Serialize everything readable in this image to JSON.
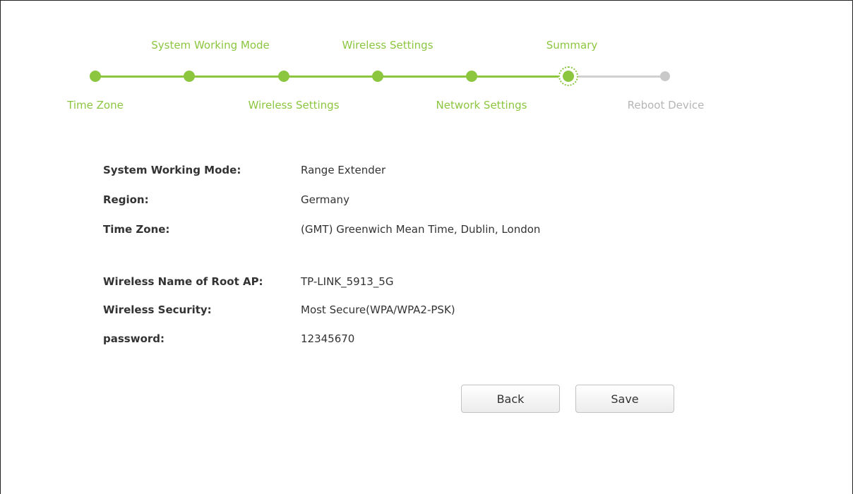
{
  "wizard": {
    "steps": [
      {
        "label": "Time Zone",
        "state": "done"
      },
      {
        "label": "System Working Mode",
        "state": "done"
      },
      {
        "label": "Wireless Settings",
        "state": "done"
      },
      {
        "label": "Wireless Settings",
        "state": "done"
      },
      {
        "label": "Network Settings",
        "state": "done"
      },
      {
        "label": "Summary",
        "state": "current"
      },
      {
        "label": "Reboot Device",
        "state": "todo"
      }
    ],
    "colors": {
      "done": "#8cc63f",
      "todo": "#c9c9c9"
    }
  },
  "summary": {
    "rows": [
      {
        "label": "System Working Mode:",
        "value": "Range Extender"
      },
      {
        "label": "Region:",
        "value": "Germany"
      },
      {
        "label": "Time Zone:",
        "value": "(GMT) Greenwich Mean Time, Dublin, London"
      },
      {
        "label": "Wireless Name of Root AP:",
        "value": "TP-LINK_5913_5G"
      },
      {
        "label": "Wireless Security:",
        "value": "Most Secure(WPA/WPA2-PSK)"
      },
      {
        "label": "password:",
        "value": "12345670"
      }
    ]
  },
  "buttons": {
    "back": "Back",
    "save": "Save"
  }
}
